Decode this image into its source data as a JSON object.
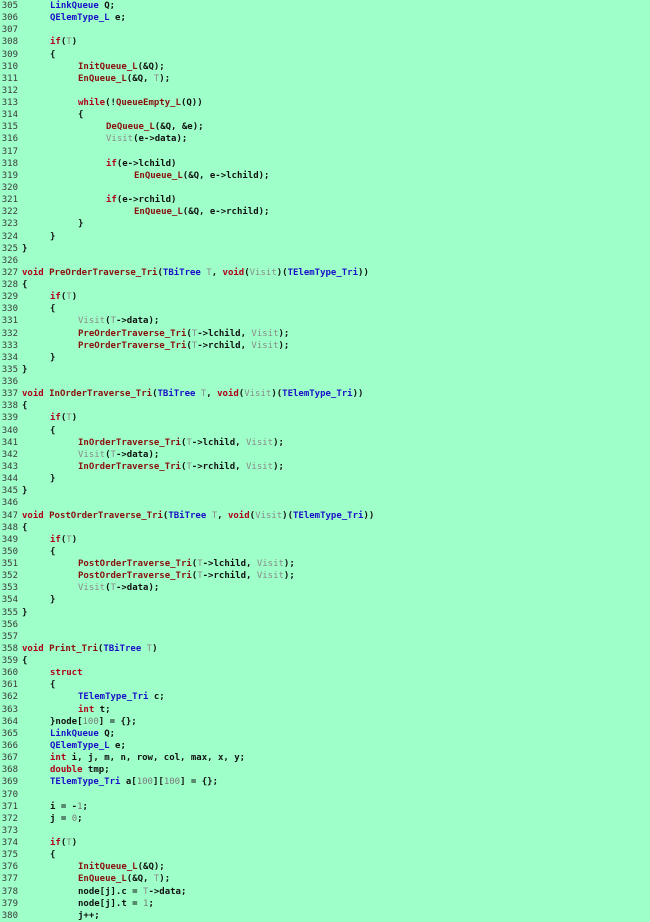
{
  "editor": {
    "colors": {
      "background": "#9effc9",
      "keyword": "#b0001a",
      "function": "#8a1010",
      "type": "#1a10c8",
      "param": "#8a8a8a",
      "number": "#7a7a7a",
      "text": "#111111",
      "line_number": "#3a3a3a"
    },
    "lines": [
      {
        "n": "305",
        "i": 1,
        "t": [
          [
            "ty",
            "LinkQueue"
          ],
          [
            "tx",
            " Q;"
          ]
        ]
      },
      {
        "n": "306",
        "i": 1,
        "t": [
          [
            "ty",
            "QElemType_L"
          ],
          [
            "tx",
            " e;"
          ]
        ]
      },
      {
        "n": "307",
        "i": 0,
        "t": []
      },
      {
        "n": "308",
        "i": 1,
        "t": [
          [
            "kw",
            "if"
          ],
          [
            "tx",
            "("
          ],
          [
            "pa",
            "T"
          ],
          [
            "tx",
            ")"
          ]
        ]
      },
      {
        "n": "309",
        "i": 1,
        "t": [
          [
            "tx",
            "{"
          ]
        ]
      },
      {
        "n": "310",
        "i": 2,
        "t": [
          [
            "fn",
            "InitQueue_L"
          ],
          [
            "tx",
            "(&Q);"
          ]
        ]
      },
      {
        "n": "311",
        "i": 2,
        "t": [
          [
            "fn",
            "EnQueue_L"
          ],
          [
            "tx",
            "(&Q, "
          ],
          [
            "pa",
            "T"
          ],
          [
            "tx",
            ");"
          ]
        ]
      },
      {
        "n": "312",
        "i": 0,
        "t": []
      },
      {
        "n": "313",
        "i": 2,
        "t": [
          [
            "kw",
            "while"
          ],
          [
            "tx",
            "(!"
          ],
          [
            "fn",
            "QueueEmpty_L"
          ],
          [
            "tx",
            "(Q))"
          ]
        ]
      },
      {
        "n": "314",
        "i": 2,
        "t": [
          [
            "tx",
            "{"
          ]
        ]
      },
      {
        "n": "315",
        "i": 3,
        "t": [
          [
            "fn",
            "DeQueue_L"
          ],
          [
            "tx",
            "(&Q, &e);"
          ]
        ]
      },
      {
        "n": "316",
        "i": 3,
        "t": [
          [
            "pa",
            "Visit"
          ],
          [
            "tx",
            "(e->data);"
          ]
        ]
      },
      {
        "n": "317",
        "i": 0,
        "t": []
      },
      {
        "n": "318",
        "i": 3,
        "t": [
          [
            "kw",
            "if"
          ],
          [
            "tx",
            "(e->lchild)"
          ]
        ]
      },
      {
        "n": "319",
        "i": 4,
        "t": [
          [
            "fn",
            "EnQueue_L"
          ],
          [
            "tx",
            "(&Q, e->lchild);"
          ]
        ]
      },
      {
        "n": "320",
        "i": 0,
        "t": []
      },
      {
        "n": "321",
        "i": 3,
        "t": [
          [
            "kw",
            "if"
          ],
          [
            "tx",
            "(e->rchild)"
          ]
        ]
      },
      {
        "n": "322",
        "i": 4,
        "t": [
          [
            "fn",
            "EnQueue_L"
          ],
          [
            "tx",
            "(&Q, e->rchild);"
          ]
        ]
      },
      {
        "n": "323",
        "i": 2,
        "t": [
          [
            "tx",
            "}"
          ]
        ]
      },
      {
        "n": "324",
        "i": 1,
        "t": [
          [
            "tx",
            "}"
          ]
        ]
      },
      {
        "n": "325",
        "i": 0,
        "t": [
          [
            "tx",
            "}"
          ]
        ]
      },
      {
        "n": "326",
        "i": 0,
        "t": []
      },
      {
        "n": "327",
        "i": 0,
        "t": [
          [
            "kw",
            "void"
          ],
          [
            "tx",
            " "
          ],
          [
            "fn",
            "PreOrderTraverse_Tri"
          ],
          [
            "tx",
            "("
          ],
          [
            "ty",
            "TBiTree"
          ],
          [
            "tx",
            " "
          ],
          [
            "pa",
            "T"
          ],
          [
            "tx",
            ", "
          ],
          [
            "kw",
            "void"
          ],
          [
            "tx",
            "("
          ],
          [
            "pa",
            "Visit"
          ],
          [
            "tx",
            ")("
          ],
          [
            "ty",
            "TElemType_Tri"
          ],
          [
            "tx",
            "))"
          ]
        ]
      },
      {
        "n": "328",
        "i": 0,
        "t": [
          [
            "tx",
            "{"
          ]
        ]
      },
      {
        "n": "329",
        "i": 1,
        "t": [
          [
            "kw",
            "if"
          ],
          [
            "tx",
            "("
          ],
          [
            "pa",
            "T"
          ],
          [
            "tx",
            ")"
          ]
        ]
      },
      {
        "n": "330",
        "i": 1,
        "t": [
          [
            "tx",
            "{"
          ]
        ]
      },
      {
        "n": "331",
        "i": 2,
        "t": [
          [
            "pa",
            "Visit"
          ],
          [
            "tx",
            "("
          ],
          [
            "pa",
            "T"
          ],
          [
            "tx",
            "->data);"
          ]
        ]
      },
      {
        "n": "332",
        "i": 2,
        "t": [
          [
            "fn",
            "PreOrderTraverse_Tri"
          ],
          [
            "tx",
            "("
          ],
          [
            "pa",
            "T"
          ],
          [
            "tx",
            "->lchild, "
          ],
          [
            "pa",
            "Visit"
          ],
          [
            "tx",
            ");"
          ]
        ]
      },
      {
        "n": "333",
        "i": 2,
        "t": [
          [
            "fn",
            "PreOrderTraverse_Tri"
          ],
          [
            "tx",
            "("
          ],
          [
            "pa",
            "T"
          ],
          [
            "tx",
            "->rchild, "
          ],
          [
            "pa",
            "Visit"
          ],
          [
            "tx",
            ");"
          ]
        ]
      },
      {
        "n": "334",
        "i": 1,
        "t": [
          [
            "tx",
            "}"
          ]
        ]
      },
      {
        "n": "335",
        "i": 0,
        "t": [
          [
            "tx",
            "}"
          ]
        ]
      },
      {
        "n": "336",
        "i": 0,
        "t": []
      },
      {
        "n": "337",
        "i": 0,
        "t": [
          [
            "kw",
            "void"
          ],
          [
            "tx",
            " "
          ],
          [
            "fn",
            "InOrderTraverse_Tri"
          ],
          [
            "tx",
            "("
          ],
          [
            "ty",
            "TBiTree"
          ],
          [
            "tx",
            " "
          ],
          [
            "pa",
            "T"
          ],
          [
            "tx",
            ", "
          ],
          [
            "kw",
            "void"
          ],
          [
            "tx",
            "("
          ],
          [
            "pa",
            "Visit"
          ],
          [
            "tx",
            ")("
          ],
          [
            "ty",
            "TElemType_Tri"
          ],
          [
            "tx",
            "))"
          ]
        ]
      },
      {
        "n": "338",
        "i": 0,
        "t": [
          [
            "tx",
            "{"
          ]
        ]
      },
      {
        "n": "339",
        "i": 1,
        "t": [
          [
            "kw",
            "if"
          ],
          [
            "tx",
            "("
          ],
          [
            "pa",
            "T"
          ],
          [
            "tx",
            ")"
          ]
        ]
      },
      {
        "n": "340",
        "i": 1,
        "t": [
          [
            "tx",
            "{"
          ]
        ]
      },
      {
        "n": "341",
        "i": 2,
        "t": [
          [
            "fn",
            "InOrderTraverse_Tri"
          ],
          [
            "tx",
            "("
          ],
          [
            "pa",
            "T"
          ],
          [
            "tx",
            "->lchild, "
          ],
          [
            "pa",
            "Visit"
          ],
          [
            "tx",
            ");"
          ]
        ]
      },
      {
        "n": "342",
        "i": 2,
        "t": [
          [
            "pa",
            "Visit"
          ],
          [
            "tx",
            "("
          ],
          [
            "pa",
            "T"
          ],
          [
            "tx",
            "->data);"
          ]
        ]
      },
      {
        "n": "343",
        "i": 2,
        "t": [
          [
            "fn",
            "InOrderTraverse_Tri"
          ],
          [
            "tx",
            "("
          ],
          [
            "pa",
            "T"
          ],
          [
            "tx",
            "->rchild, "
          ],
          [
            "pa",
            "Visit"
          ],
          [
            "tx",
            ");"
          ]
        ]
      },
      {
        "n": "344",
        "i": 1,
        "t": [
          [
            "tx",
            "}"
          ]
        ]
      },
      {
        "n": "345",
        "i": 0,
        "t": [
          [
            "tx",
            "}"
          ]
        ]
      },
      {
        "n": "346",
        "i": 0,
        "t": []
      },
      {
        "n": "347",
        "i": 0,
        "t": [
          [
            "kw",
            "void"
          ],
          [
            "tx",
            " "
          ],
          [
            "fn",
            "PostOrderTraverse_Tri"
          ],
          [
            "tx",
            "("
          ],
          [
            "ty",
            "TBiTree"
          ],
          [
            "tx",
            " "
          ],
          [
            "pa",
            "T"
          ],
          [
            "tx",
            ", "
          ],
          [
            "kw",
            "void"
          ],
          [
            "tx",
            "("
          ],
          [
            "pa",
            "Visit"
          ],
          [
            "tx",
            ")("
          ],
          [
            "ty",
            "TElemType_Tri"
          ],
          [
            "tx",
            "))"
          ]
        ]
      },
      {
        "n": "348",
        "i": 0,
        "t": [
          [
            "tx",
            "{"
          ]
        ]
      },
      {
        "n": "349",
        "i": 1,
        "t": [
          [
            "kw",
            "if"
          ],
          [
            "tx",
            "("
          ],
          [
            "pa",
            "T"
          ],
          [
            "tx",
            ")"
          ]
        ]
      },
      {
        "n": "350",
        "i": 1,
        "t": [
          [
            "tx",
            "{"
          ]
        ]
      },
      {
        "n": "351",
        "i": 2,
        "t": [
          [
            "fn",
            "PostOrderTraverse_Tri"
          ],
          [
            "tx",
            "("
          ],
          [
            "pa",
            "T"
          ],
          [
            "tx",
            "->lchild, "
          ],
          [
            "pa",
            "Visit"
          ],
          [
            "tx",
            ");"
          ]
        ]
      },
      {
        "n": "352",
        "i": 2,
        "t": [
          [
            "fn",
            "PostOrderTraverse_Tri"
          ],
          [
            "tx",
            "("
          ],
          [
            "pa",
            "T"
          ],
          [
            "tx",
            "->rchild, "
          ],
          [
            "pa",
            "Visit"
          ],
          [
            "tx",
            ");"
          ]
        ]
      },
      {
        "n": "353",
        "i": 2,
        "t": [
          [
            "pa",
            "Visit"
          ],
          [
            "tx",
            "("
          ],
          [
            "pa",
            "T"
          ],
          [
            "tx",
            "->data);"
          ]
        ]
      },
      {
        "n": "354",
        "i": 1,
        "t": [
          [
            "tx",
            "}"
          ]
        ]
      },
      {
        "n": "355",
        "i": 0,
        "t": [
          [
            "tx",
            "}"
          ]
        ]
      },
      {
        "n": "356",
        "i": 0,
        "t": []
      },
      {
        "n": "357",
        "i": 0,
        "t": []
      },
      {
        "n": "358",
        "i": 0,
        "t": [
          [
            "kw",
            "void"
          ],
          [
            "tx",
            " "
          ],
          [
            "fn",
            "Print_Tri"
          ],
          [
            "tx",
            "("
          ],
          [
            "ty",
            "TBiTree"
          ],
          [
            "tx",
            " "
          ],
          [
            "pa",
            "T"
          ],
          [
            "tx",
            ")"
          ]
        ]
      },
      {
        "n": "359",
        "i": 0,
        "t": [
          [
            "tx",
            "{"
          ]
        ]
      },
      {
        "n": "360",
        "i": 1,
        "t": [
          [
            "kw",
            "struct"
          ]
        ]
      },
      {
        "n": "361",
        "i": 1,
        "t": [
          [
            "tx",
            "{"
          ]
        ]
      },
      {
        "n": "362",
        "i": 2,
        "t": [
          [
            "ty",
            "TElemType_Tri"
          ],
          [
            "tx",
            " c;"
          ]
        ]
      },
      {
        "n": "363",
        "i": 2,
        "t": [
          [
            "kw",
            "int"
          ],
          [
            "tx",
            " t;"
          ]
        ]
      },
      {
        "n": "364",
        "i": 1,
        "t": [
          [
            "tx",
            "}node["
          ],
          [
            "nm",
            "100"
          ],
          [
            "tx",
            "] = {};"
          ]
        ]
      },
      {
        "n": "365",
        "i": 1,
        "t": [
          [
            "ty",
            "LinkQueue"
          ],
          [
            "tx",
            " Q;"
          ]
        ]
      },
      {
        "n": "366",
        "i": 1,
        "t": [
          [
            "ty",
            "QElemType_L"
          ],
          [
            "tx",
            " e;"
          ]
        ]
      },
      {
        "n": "367",
        "i": 1,
        "t": [
          [
            "kw",
            "int"
          ],
          [
            "tx",
            " i, j, m, n, row, col, max, x, y;"
          ]
        ]
      },
      {
        "n": "368",
        "i": 1,
        "t": [
          [
            "kw",
            "double"
          ],
          [
            "tx",
            " tmp;"
          ]
        ]
      },
      {
        "n": "369",
        "i": 1,
        "t": [
          [
            "ty",
            "TElemType_Tri"
          ],
          [
            "tx",
            " a["
          ],
          [
            "nm",
            "100"
          ],
          [
            "tx",
            "]["
          ],
          [
            "nm",
            "100"
          ],
          [
            "tx",
            "] = {};"
          ]
        ]
      },
      {
        "n": "370",
        "i": 0,
        "t": []
      },
      {
        "n": "371",
        "i": 1,
        "t": [
          [
            "tx",
            "i = -"
          ],
          [
            "nm",
            "1"
          ],
          [
            "tx",
            ";"
          ]
        ]
      },
      {
        "n": "372",
        "i": 1,
        "t": [
          [
            "tx",
            "j = "
          ],
          [
            "nm",
            "0"
          ],
          [
            "tx",
            ";"
          ]
        ]
      },
      {
        "n": "373",
        "i": 0,
        "t": []
      },
      {
        "n": "374",
        "i": 1,
        "t": [
          [
            "kw",
            "if"
          ],
          [
            "tx",
            "("
          ],
          [
            "pa",
            "T"
          ],
          [
            "tx",
            ")"
          ]
        ]
      },
      {
        "n": "375",
        "i": 1,
        "t": [
          [
            "tx",
            "{"
          ]
        ]
      },
      {
        "n": "376",
        "i": 2,
        "t": [
          [
            "fn",
            "InitQueue_L"
          ],
          [
            "tx",
            "(&Q);"
          ]
        ]
      },
      {
        "n": "377",
        "i": 2,
        "t": [
          [
            "fn",
            "EnQueue_L"
          ],
          [
            "tx",
            "(&Q, "
          ],
          [
            "pa",
            "T"
          ],
          [
            "tx",
            ");"
          ]
        ]
      },
      {
        "n": "378",
        "i": 2,
        "t": [
          [
            "tx",
            "node[j].c = "
          ],
          [
            "pa",
            "T"
          ],
          [
            "tx",
            "->data;"
          ]
        ]
      },
      {
        "n": "379",
        "i": 2,
        "t": [
          [
            "tx",
            "node[j].t = "
          ],
          [
            "nm",
            "1"
          ],
          [
            "tx",
            ";"
          ]
        ]
      },
      {
        "n": "380",
        "i": 2,
        "t": [
          [
            "tx",
            "j++;"
          ]
        ]
      }
    ]
  }
}
